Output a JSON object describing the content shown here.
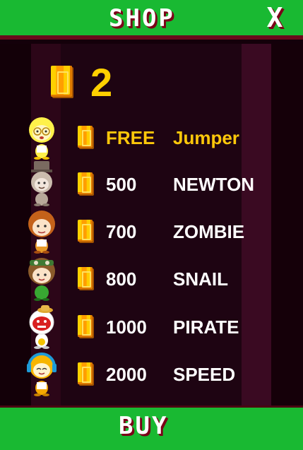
{
  "header": {
    "title": "SHOP",
    "close_label": "X"
  },
  "balance": {
    "coins": "2"
  },
  "items": [
    {
      "price": "FREE",
      "name": "Jumper",
      "selected": true
    },
    {
      "price": "500",
      "name": "NEWTON",
      "selected": false
    },
    {
      "price": "700",
      "name": "ZOMBIE",
      "selected": false
    },
    {
      "price": "800",
      "name": "SNAIL",
      "selected": false
    },
    {
      "price": "1000",
      "name": "PIRATE",
      "selected": false
    },
    {
      "price": "2000",
      "name": "SPEED",
      "selected": false
    }
  ],
  "footer": {
    "buy_label": "BUY"
  },
  "colors": {
    "green": "#19b932",
    "gold": "#ffc80a",
    "coin": "#ff9e00",
    "maroon": "#6a0a1c"
  },
  "icons": [
    "coin-icon",
    "close-icon",
    "jumper-avatar",
    "newton-avatar",
    "zombie-avatar",
    "snail-avatar",
    "pirate-avatar",
    "speed-avatar"
  ]
}
